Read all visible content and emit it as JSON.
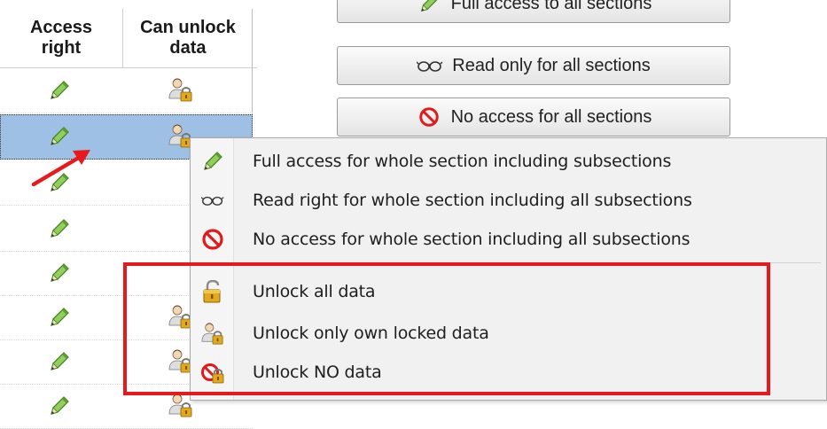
{
  "grid": {
    "headers": {
      "access_right": "Access\nright",
      "can_unlock_data": "Can unlock\ndata"
    },
    "rows": [
      {
        "access": "pencil-icon",
        "unlock": "user-lock-icon",
        "selected": false
      },
      {
        "access": "pencil-icon",
        "unlock": "user-lock-icon",
        "selected": true
      },
      {
        "access": "pencil-icon",
        "unlock": "",
        "selected": false
      },
      {
        "access": "pencil-icon",
        "unlock": "",
        "selected": false
      },
      {
        "access": "pencil-icon",
        "unlock": "",
        "selected": false
      },
      {
        "access": "pencil-icon",
        "unlock": "user-lock-icon",
        "selected": false
      },
      {
        "access": "pencil-icon",
        "unlock": "user-lock-icon",
        "selected": false
      },
      {
        "access": "pencil-icon",
        "unlock": "user-lock-icon",
        "selected": false
      }
    ],
    "selected_color": "#9dc0e4"
  },
  "buttons": {
    "full_access": {
      "label": "Full access to all sections",
      "icon": "pencil-icon"
    },
    "read_only": {
      "label": "Read only for all sections",
      "icon": "glasses-icon"
    },
    "no_access": {
      "label": "No access for all sections",
      "icon": "no-entry-icon"
    }
  },
  "context_menu": {
    "items": [
      {
        "label": "Full access for whole section including subsections",
        "icon": "pencil-icon"
      },
      {
        "label": "Read right for whole section including all subsections",
        "icon": "glasses-icon"
      },
      {
        "label": "No access for whole section including all subsections",
        "icon": "no-entry-icon"
      },
      {
        "label": "Unlock all data",
        "icon": "open-lock-icon"
      },
      {
        "label": "Unlock only own locked data",
        "icon": "user-lock-icon"
      },
      {
        "label": "Unlock NO data",
        "icon": "no-unlock-icon"
      }
    ]
  },
  "annotation": {
    "color": "#e8191d"
  }
}
